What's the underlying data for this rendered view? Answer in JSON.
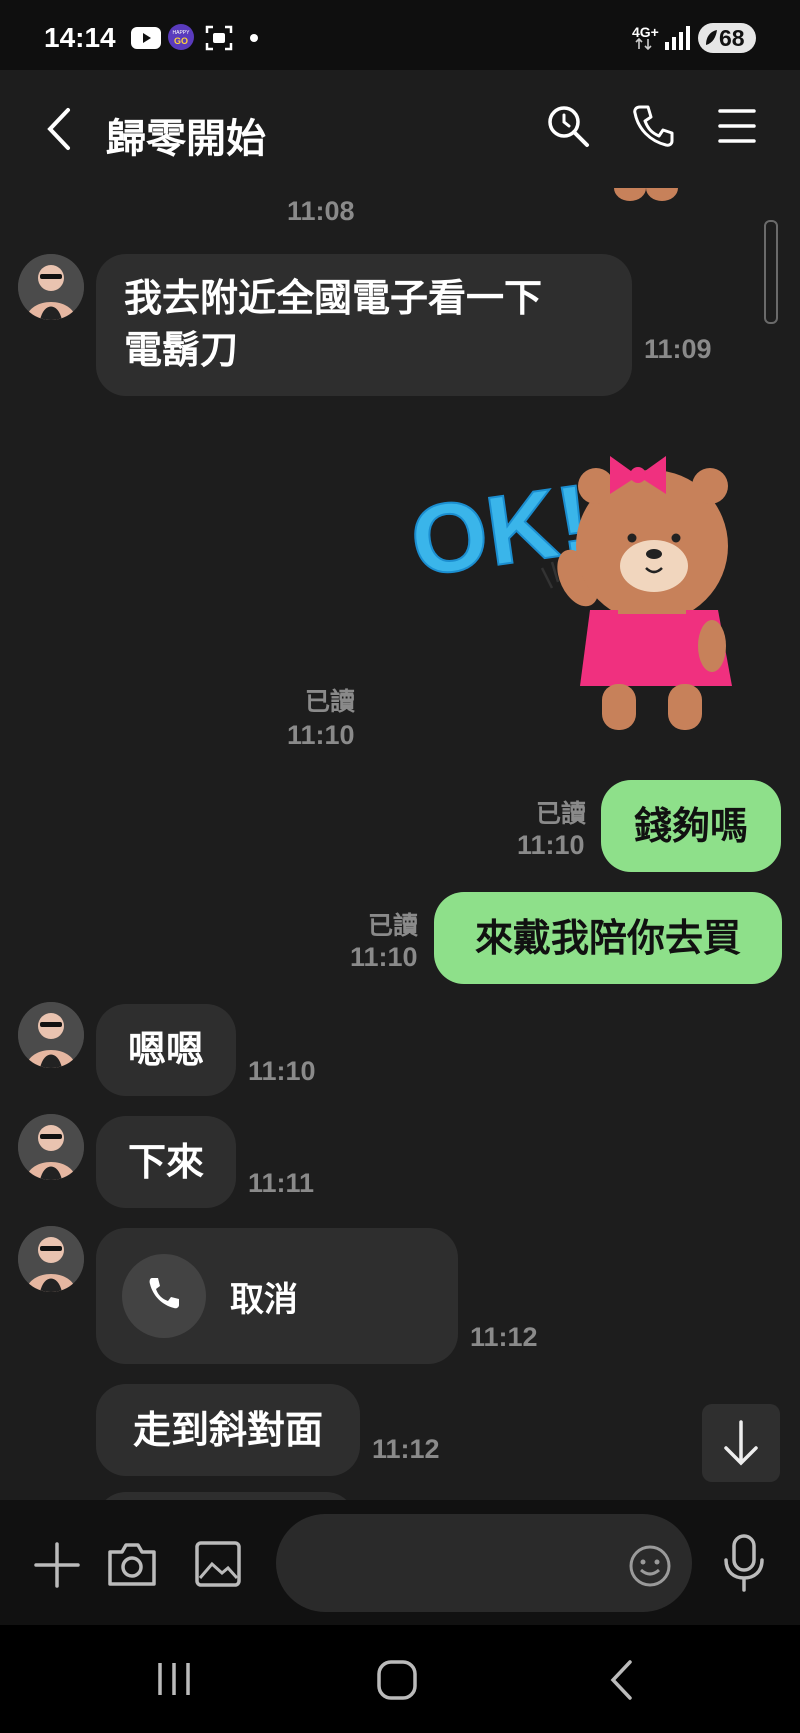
{
  "status_bar": {
    "time": "14:14",
    "network": "4G+",
    "battery": "68",
    "happy_go_label": "HAPPY GO"
  },
  "header": {
    "title": "歸零開始"
  },
  "messages": {
    "t0": "11:08",
    "m1": {
      "line1": "我去附近全國電子看一下",
      "line2": "電鬍刀",
      "time": "11:09"
    },
    "sticker": {
      "text": "OK!",
      "read": "已讀",
      "time": "11:10"
    },
    "m3": {
      "text": "錢夠嗎",
      "read": "已讀",
      "time": "11:10"
    },
    "m4": {
      "text": "來戴我陪你去買",
      "read": "已讀",
      "time": "11:10"
    },
    "m5": {
      "text": "嗯嗯",
      "time": "11:10"
    },
    "m6": {
      "text": "下來",
      "time": "11:11"
    },
    "m7": {
      "call_text": "取消",
      "time": "11:12"
    },
    "m8": {
      "text": "走到斜對面",
      "time": "11:12"
    }
  },
  "colors": {
    "outgoing_bubble": "#8ee08a",
    "incoming_bubble": "#2e2e2e",
    "chat_bg": "#1d1d1d"
  }
}
